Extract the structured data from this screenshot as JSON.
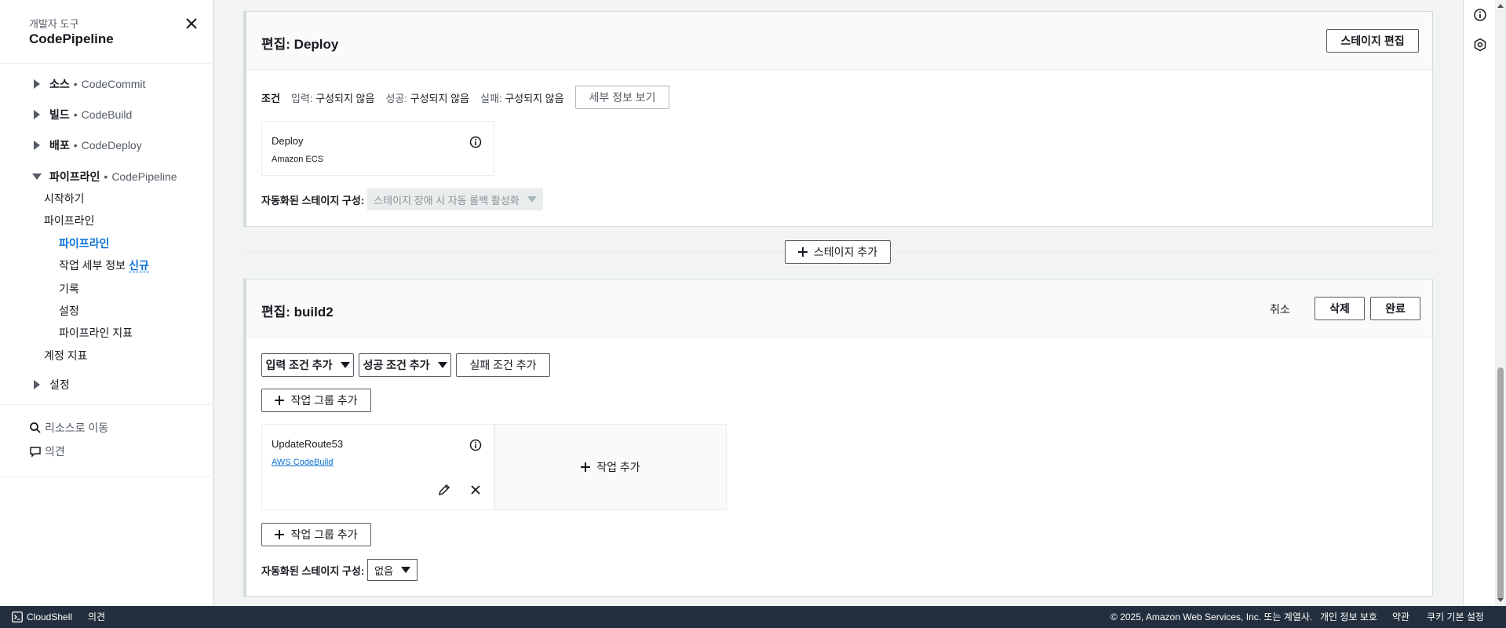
{
  "sidebar": {
    "subtitle": "개발자 도구",
    "title": "CodePipeline",
    "sections": [
      {
        "label": "소스",
        "service": "CodeCommit"
      },
      {
        "label": "빌드",
        "service": "CodeBuild"
      },
      {
        "label": "배포",
        "service": "CodeDeploy"
      },
      {
        "label": "파이프라인",
        "service": "CodePipeline"
      }
    ],
    "separator": "•",
    "pipeline_items": {
      "getting_started": "시작하기",
      "pipeline_group": "파이프라인",
      "pipelines": "파이프라인",
      "job_details": "작업 세부 정보",
      "new_badge": "신규",
      "history": "기록",
      "settings": "설정",
      "pipeline_metrics": "파이프라인 지표",
      "account_metrics": "계정 지표"
    },
    "settings_section": "설정",
    "go_to_resource": "리소스로 이동",
    "feedback": "의견"
  },
  "deploy_stage": {
    "title": "편집: Deploy",
    "edit_button": "스테이지 편집",
    "conditions_label": "조건",
    "entry_key": "입력:",
    "entry_value": "구성되지 않음",
    "success_key": "성공:",
    "success_value": "구성되지 않음",
    "failure_key": "실패:",
    "failure_value": "구성되지 않음",
    "details_button": "세부 정보 보기",
    "action": {
      "name": "Deploy",
      "provider": "Amazon ECS"
    },
    "auto_config_label": "자동화된 스테이지 구성:",
    "auto_config_value": "스테이지 장애 시 자동 롤백 활성화"
  },
  "add_stage_button": "스테이지 추가",
  "build2_stage": {
    "title": "편집: build2",
    "cancel": "취소",
    "delete": "삭제",
    "done": "완료",
    "entry_condition_button": "입력 조건 추가",
    "success_condition_button": "성공 조건 추가",
    "failure_condition_button": "실패 조건 추가",
    "add_action_group": "작업 그룹 추가",
    "action": {
      "name": "UpdateRoute53",
      "provider": "AWS CodeBuild"
    },
    "add_action": "작업 추가",
    "auto_config_label": "자동화된 스테이지 구성:",
    "auto_config_value": "없음"
  },
  "footer": {
    "cloudshell": "CloudShell",
    "feedback": "의견",
    "copyright": "© 2025, Amazon Web Services, Inc. 또는 계열사.",
    "privacy": "개인 정보 보호",
    "terms": "약관",
    "cookie_prefs": "쿠키 기본 설정"
  }
}
